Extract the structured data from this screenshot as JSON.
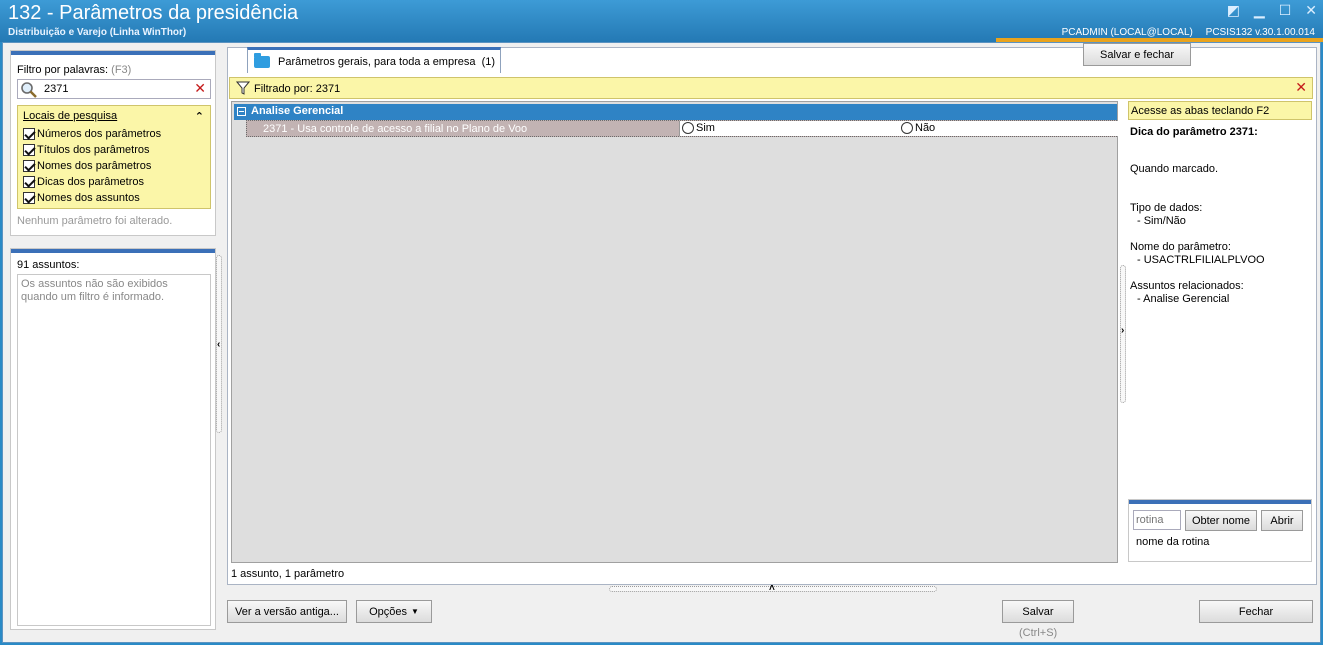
{
  "window": {
    "title": "132 - Parâmetros da presidência",
    "subtitle": "Distribuição e Varejo (Linha WinThor)",
    "user": "PCADMIN (LOCAL@LOCAL)",
    "version": "PCSIS132  v.30.1.00.014",
    "accent_color": "#e9a31d"
  },
  "filter": {
    "label": "Filtro por palavras:",
    "shortcut": "(F3)",
    "value": "2371",
    "locais_title": "Locais de pesquisa",
    "options": [
      {
        "label": "Números dos parâmetros",
        "checked": true
      },
      {
        "label": "Títulos dos parâmetros",
        "checked": true
      },
      {
        "label": "Nomes dos parâmetros",
        "checked": true
      },
      {
        "label": "Dicas dos parâmetros",
        "checked": true
      },
      {
        "label": "Nomes dos assuntos",
        "checked": true
      }
    ],
    "no_change": "Nenhum parâmetro foi alterado."
  },
  "subjects": {
    "count_label": "91 assuntos:",
    "message": "Os assuntos não são exibidos quando um filtro é informado."
  },
  "tab": {
    "label": "Parâmetros gerais, para toda a empresa",
    "count": "(1)"
  },
  "filtered_bar": {
    "label": "Filtrado por: 2371"
  },
  "grid": {
    "group_label": "Analise Gerencial",
    "param_label": "2371 - Usa controle de acesso a filial no Plano de Voo",
    "options": [
      "Sim",
      "Não"
    ],
    "group_color": "#2f83c5",
    "row_color": "#c2b3b3"
  },
  "status": "1 assunto, 1 parâmetro",
  "hint": {
    "f2": "Acesse as abas teclando F2",
    "title": "Dica do parâmetro 2371:",
    "description": "Quando marcado.",
    "data_type_label": "Tipo de dados:",
    "data_type_value": "- Sim/Não",
    "param_name_label": "Nome do parâmetro:",
    "param_name_value": "- USACTRLFILIALPLVOO",
    "related_label": "Assuntos relacionados:",
    "related_value": "- Analise Gerencial"
  },
  "rotina": {
    "placeholder": "rotina",
    "obter_nome": "Obter nome",
    "abrir": "Abrir",
    "caption": "nome da rotina"
  },
  "buttons": {
    "old_version": "Ver a versão antiga...",
    "options": "Opções",
    "save": "Salvar",
    "save_shortcut": "(Ctrl+S)",
    "save_close": "Salvar e fechar",
    "close": "Fechar"
  }
}
